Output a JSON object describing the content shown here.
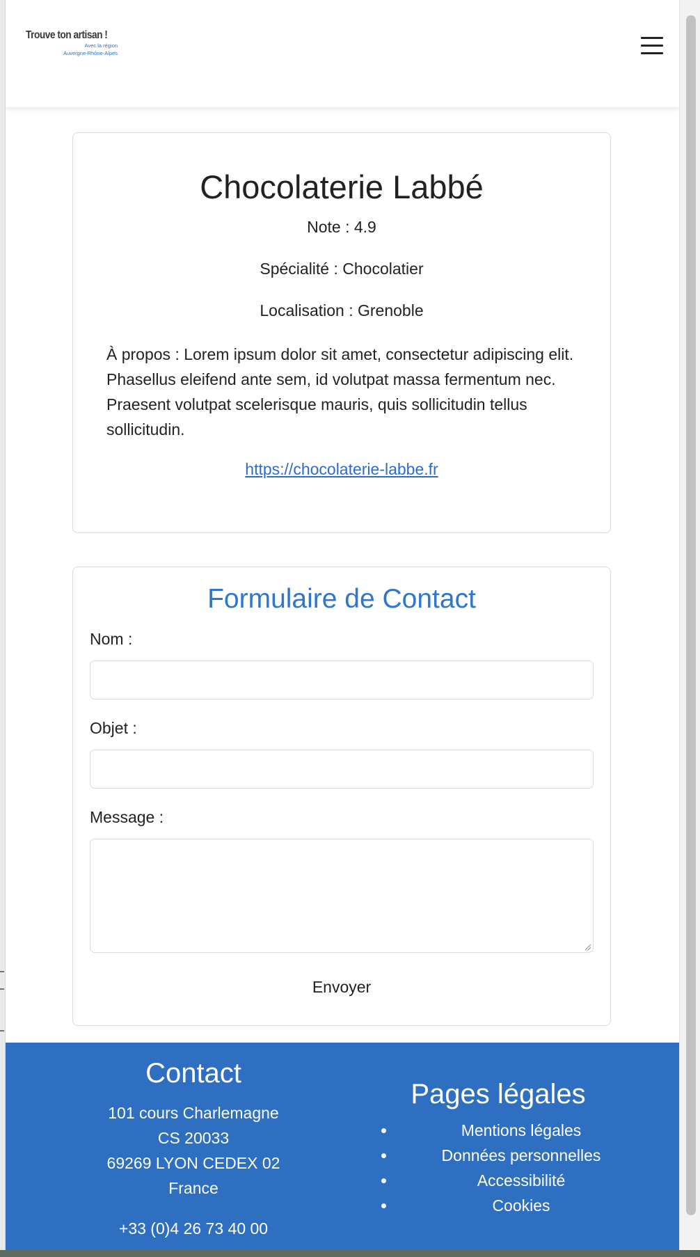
{
  "header": {
    "logo_main": "Trouve ton artisan !",
    "logo_sub_1": "Avec la région",
    "logo_sub_2": "Auvergne-Rhône-Alpes",
    "menu_icon": "hamburger-menu-icon"
  },
  "profile": {
    "name": "Chocolaterie Labbé",
    "rating": "Note : 4.9",
    "specialty": "Spécialité : Chocolatier",
    "location": "Localisation : Grenoble",
    "about": "À propos : Lorem ipsum dolor sit amet, consectetur adipiscing elit. Phasellus eleifend ante sem, id volutpat massa fermentum nec. Praesent volutpat scelerisque mauris, quis sollicitudin tellus sollicitudin.",
    "website": "https://chocolaterie-labbe.fr"
  },
  "contact_form": {
    "title": "Formulaire de Contact",
    "name_label": "Nom :",
    "subject_label": "Objet :",
    "message_label": "Message :",
    "submit_label": "Envoyer",
    "name_value": "",
    "subject_value": "",
    "message_value": ""
  },
  "footer": {
    "contact_title": "Contact",
    "address_1": "101 cours Charlemagne",
    "address_2": "CS 20033",
    "address_3": "69269 LYON CEDEX 02",
    "address_4": "France",
    "phone": "+33 (0)4 26 73 40 00",
    "legal_title": "Pages légales",
    "legal_links": [
      "Mentions légales",
      "Données personnelles",
      "Accessibilité",
      "Cookies"
    ]
  },
  "colors": {
    "accent": "#2f76cc",
    "footer_bg": "#2f6fc2",
    "link": "#2c6bd1"
  }
}
